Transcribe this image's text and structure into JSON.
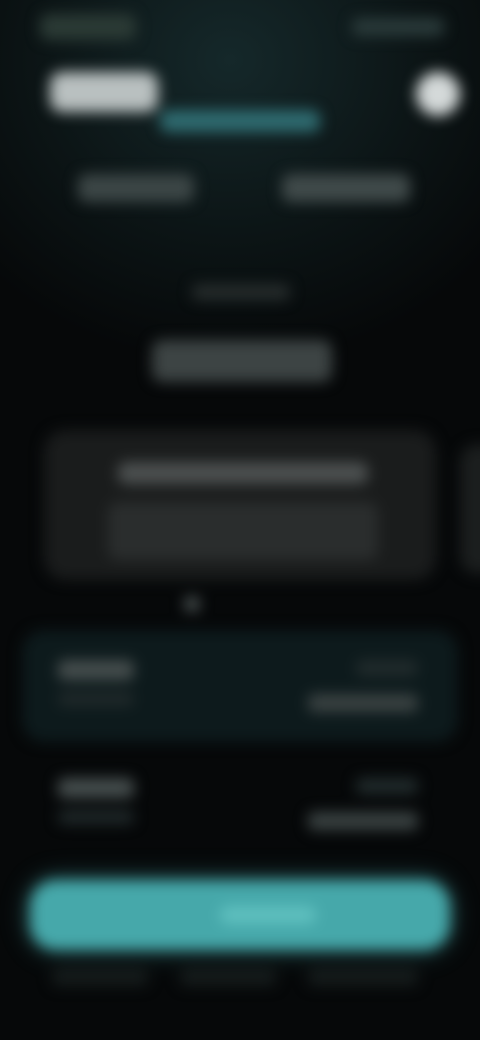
{
  "colors": {
    "background": "#050708",
    "card": "#1a1c1c",
    "accent": "#46a8aa",
    "row_highlight": "#0d1a1c"
  },
  "icons": {
    "profile": "profile-icon"
  }
}
